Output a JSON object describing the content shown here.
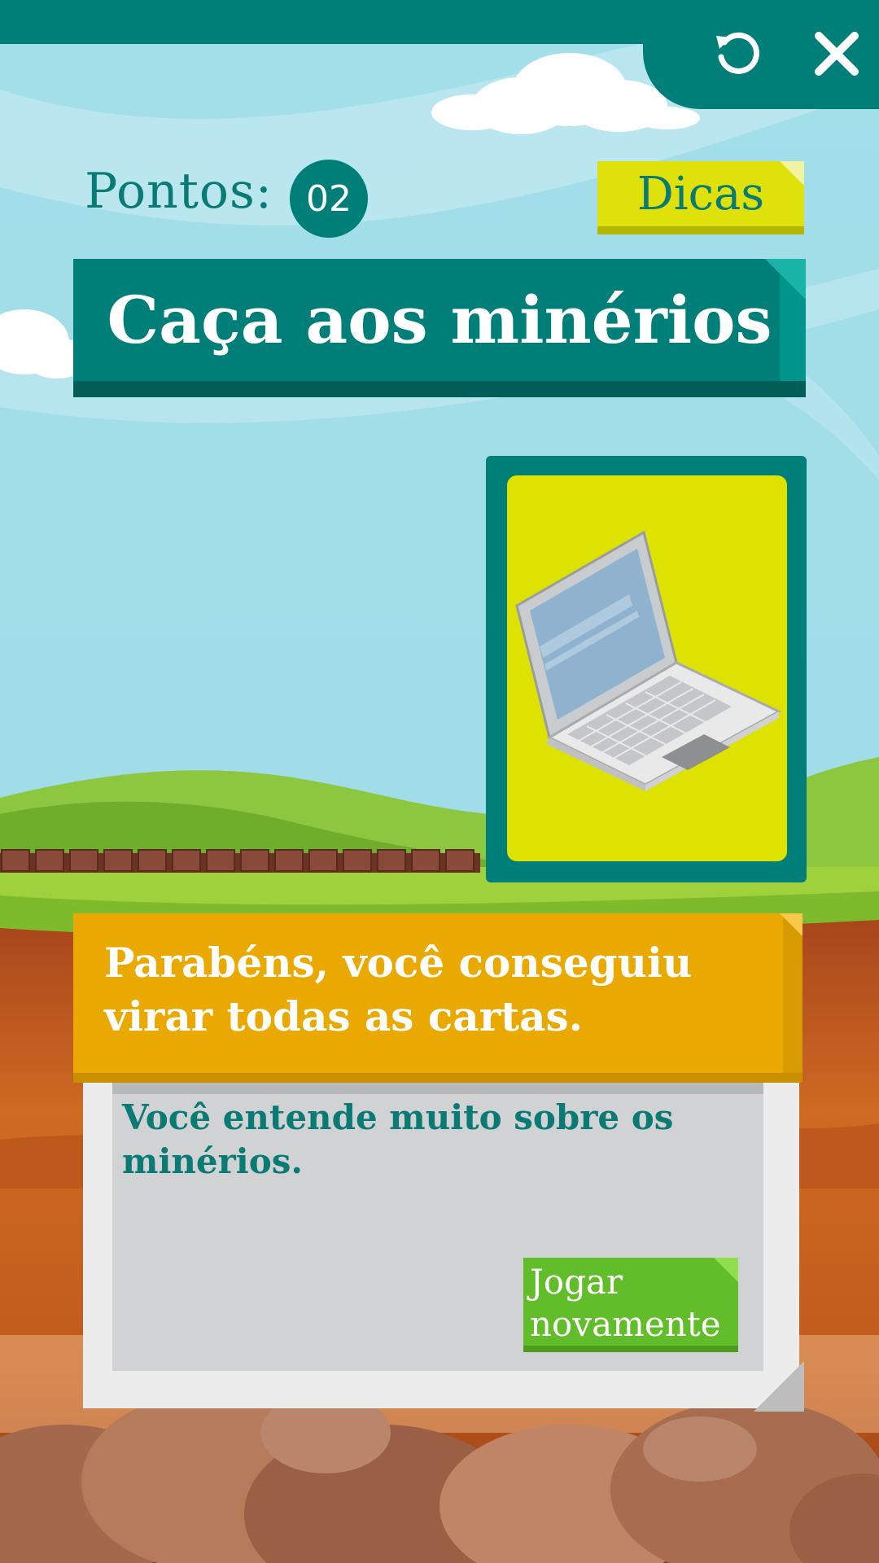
{
  "header": {
    "restart_icon": "restart-icon",
    "close_icon": "close-icon"
  },
  "score": {
    "label": "Pontos:",
    "value": "02"
  },
  "hints": {
    "label": "Dicas"
  },
  "title": "Caça aos minérios",
  "card": {
    "image": "laptop-icon"
  },
  "message": {
    "title": "Parabéns, você conseguiu virar todas as cartas.",
    "body": "Você entende muito sobre os minérios.",
    "replay_label": "Jogar novamente"
  },
  "colors": {
    "teal": "#007f78",
    "yellow": "#dee200",
    "orange": "#e9a900",
    "green": "#62bd2a"
  }
}
